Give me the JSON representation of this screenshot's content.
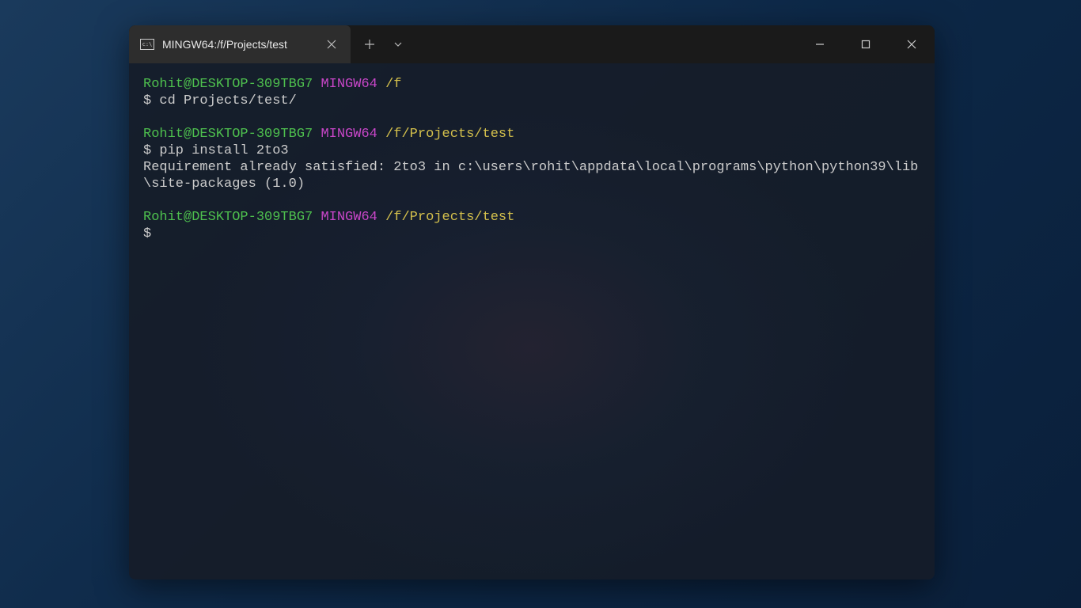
{
  "tab": {
    "title": "MINGW64:/f/Projects/test"
  },
  "blocks": [
    {
      "userHost": "Rohit@DESKTOP-309TBG7",
      "mingw": "MINGW64",
      "path": "/f",
      "promptSymbol": "$",
      "command": "cd Projects/test/",
      "outputs": []
    },
    {
      "userHost": "Rohit@DESKTOP-309TBG7",
      "mingw": "MINGW64",
      "path": "/f/Projects/test",
      "promptSymbol": "$",
      "command": "pip install 2to3",
      "outputs": [
        "Requirement already satisfied: 2to3 in c:\\users\\rohit\\appdata\\local\\programs\\python\\python39\\lib\\site-packages (1.0)"
      ]
    },
    {
      "userHost": "Rohit@DESKTOP-309TBG7",
      "mingw": "MINGW64",
      "path": "/f/Projects/test",
      "promptSymbol": "$",
      "command": "",
      "outputs": []
    }
  ]
}
